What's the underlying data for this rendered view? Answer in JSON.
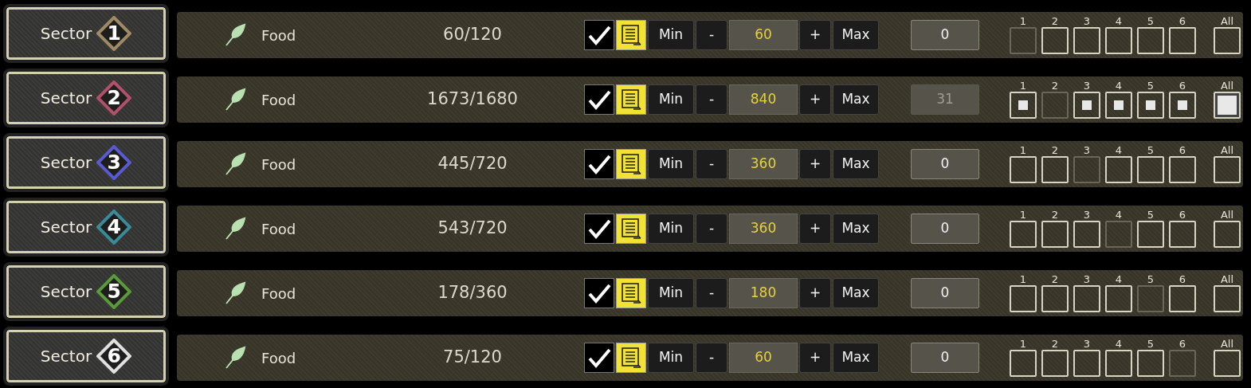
{
  "rows": [
    {
      "sector": {
        "label": "Sector",
        "number": "1",
        "color": "#a08a66"
      },
      "resource": "Food",
      "amount": "60/120",
      "enabled": true,
      "auto": true,
      "min": "Min",
      "minus": "-",
      "value": "60",
      "plus": "+",
      "max": "Max",
      "quantity": {
        "value": "0",
        "disabled": false
      },
      "targets": [
        {
          "label": "1",
          "checked": false,
          "disabled": true
        },
        {
          "label": "2",
          "checked": false,
          "disabled": false
        },
        {
          "label": "3",
          "checked": false,
          "disabled": false
        },
        {
          "label": "4",
          "checked": false,
          "disabled": false
        },
        {
          "label": "5",
          "checked": false,
          "disabled": false
        },
        {
          "label": "6",
          "checked": false,
          "disabled": false
        }
      ],
      "all": {
        "label": "All",
        "checked": false
      }
    },
    {
      "sector": {
        "label": "Sector",
        "number": "2",
        "color": "#b0506a"
      },
      "resource": "Food",
      "amount": "1673/1680",
      "enabled": true,
      "auto": true,
      "min": "Min",
      "minus": "-",
      "value": "840",
      "plus": "+",
      "max": "Max",
      "quantity": {
        "value": "31",
        "disabled": true
      },
      "targets": [
        {
          "label": "1",
          "checked": true,
          "disabled": false
        },
        {
          "label": "2",
          "checked": false,
          "disabled": true
        },
        {
          "label": "3",
          "checked": true,
          "disabled": false
        },
        {
          "label": "4",
          "checked": true,
          "disabled": false
        },
        {
          "label": "5",
          "checked": true,
          "disabled": false
        },
        {
          "label": "6",
          "checked": true,
          "disabled": false
        }
      ],
      "all": {
        "label": "All",
        "checked": true
      }
    },
    {
      "sector": {
        "label": "Sector",
        "number": "3",
        "color": "#5a5ad0"
      },
      "resource": "Food",
      "amount": "445/720",
      "enabled": true,
      "auto": true,
      "min": "Min",
      "minus": "-",
      "value": "360",
      "plus": "+",
      "max": "Max",
      "quantity": {
        "value": "0",
        "disabled": false
      },
      "targets": [
        {
          "label": "1",
          "checked": false,
          "disabled": false
        },
        {
          "label": "2",
          "checked": false,
          "disabled": false
        },
        {
          "label": "3",
          "checked": false,
          "disabled": true
        },
        {
          "label": "4",
          "checked": false,
          "disabled": false
        },
        {
          "label": "5",
          "checked": false,
          "disabled": false
        },
        {
          "label": "6",
          "checked": false,
          "disabled": false
        }
      ],
      "all": {
        "label": "All",
        "checked": false
      }
    },
    {
      "sector": {
        "label": "Sector",
        "number": "4",
        "color": "#3a8a9a"
      },
      "resource": "Food",
      "amount": "543/720",
      "enabled": true,
      "auto": true,
      "min": "Min",
      "minus": "-",
      "value": "360",
      "plus": "+",
      "max": "Max",
      "quantity": {
        "value": "0",
        "disabled": false
      },
      "targets": [
        {
          "label": "1",
          "checked": false,
          "disabled": false
        },
        {
          "label": "2",
          "checked": false,
          "disabled": false
        },
        {
          "label": "3",
          "checked": false,
          "disabled": false
        },
        {
          "label": "4",
          "checked": false,
          "disabled": true
        },
        {
          "label": "5",
          "checked": false,
          "disabled": false
        },
        {
          "label": "6",
          "checked": false,
          "disabled": false
        }
      ],
      "all": {
        "label": "All",
        "checked": false
      }
    },
    {
      "sector": {
        "label": "Sector",
        "number": "5",
        "color": "#5a9a3a"
      },
      "resource": "Food",
      "amount": "178/360",
      "enabled": true,
      "auto": true,
      "min": "Min",
      "minus": "-",
      "value": "180",
      "plus": "+",
      "max": "Max",
      "quantity": {
        "value": "0",
        "disabled": false
      },
      "targets": [
        {
          "label": "1",
          "checked": false,
          "disabled": false
        },
        {
          "label": "2",
          "checked": false,
          "disabled": false
        },
        {
          "label": "3",
          "checked": false,
          "disabled": false
        },
        {
          "label": "4",
          "checked": false,
          "disabled": false
        },
        {
          "label": "5",
          "checked": false,
          "disabled": true
        },
        {
          "label": "6",
          "checked": false,
          "disabled": false
        }
      ],
      "all": {
        "label": "All",
        "checked": false
      }
    },
    {
      "sector": {
        "label": "Sector",
        "number": "6",
        "color": "#e0e0e0"
      },
      "resource": "Food",
      "amount": "75/120",
      "enabled": true,
      "auto": true,
      "min": "Min",
      "minus": "-",
      "value": "60",
      "plus": "+",
      "max": "Max",
      "quantity": {
        "value": "0",
        "disabled": false
      },
      "targets": [
        {
          "label": "1",
          "checked": false,
          "disabled": false
        },
        {
          "label": "2",
          "checked": false,
          "disabled": false
        },
        {
          "label": "3",
          "checked": false,
          "disabled": false
        },
        {
          "label": "4",
          "checked": false,
          "disabled": false
        },
        {
          "label": "5",
          "checked": false,
          "disabled": false
        },
        {
          "label": "6",
          "checked": false,
          "disabled": true
        }
      ],
      "all": {
        "label": "All",
        "checked": false
      }
    }
  ]
}
